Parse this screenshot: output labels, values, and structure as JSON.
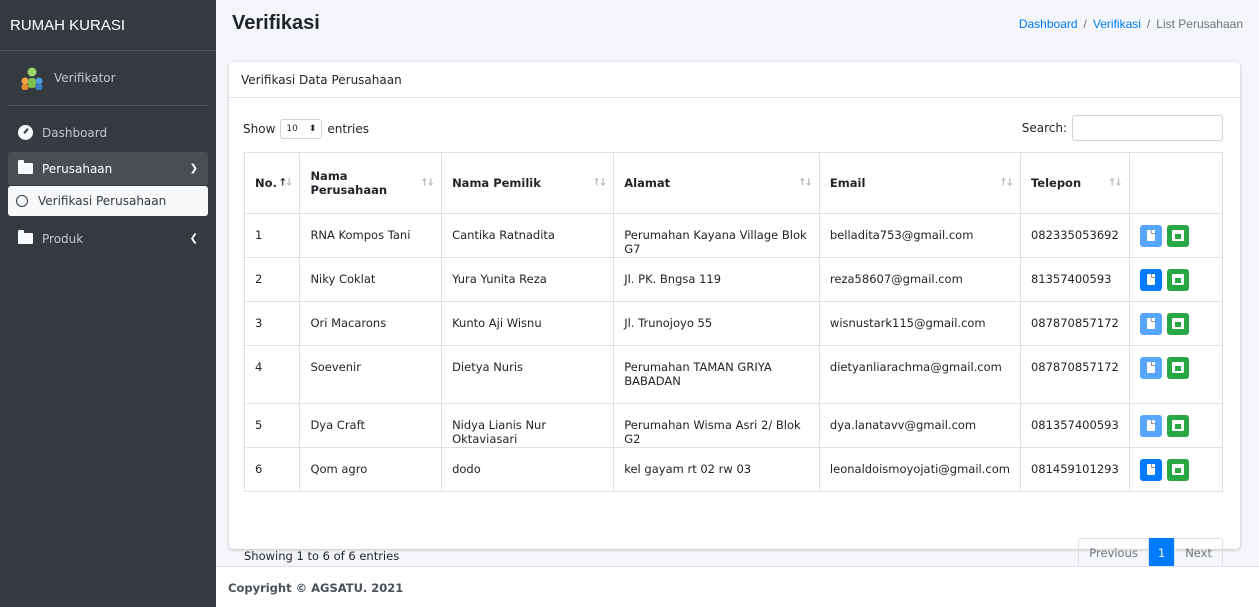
{
  "brand": "RUMAH KURASI",
  "user": {
    "name": "Verifikator"
  },
  "nav": {
    "dashboard": "Dashboard",
    "perusahaan": "Perusahaan",
    "verifikasi_perusahaan": "Verifikasi Perusahaan",
    "produk": "Produk"
  },
  "header": {
    "title": "Verifikasi",
    "breadcrumb": [
      "Dashboard",
      "Verifikasi",
      "List Perusahaan"
    ]
  },
  "card": {
    "title": "Verifikasi Data Perusahaan",
    "show_label": "Show",
    "entries_value": "10",
    "entries_label": "entries",
    "search_label": "Search:"
  },
  "table": {
    "columns": [
      "No.",
      "Nama Perusahaan",
      "Nama Pemilik",
      "Alamat",
      "Email",
      "Telepon"
    ],
    "rows": [
      {
        "no": "1",
        "nama": "RNA Kompos Tani",
        "pemilik": "Cantika Ratnadita",
        "alamat": "Perumahan Kayana Village Blok G7",
        "email": "belladita753@gmail.com",
        "telepon": "082335053692"
      },
      {
        "no": "2",
        "nama": "Niky Coklat",
        "pemilik": "Yura Yunita Reza",
        "alamat": "Jl. PK. Bngsa 119",
        "email": "reza58607@gmail.com",
        "telepon": "81357400593"
      },
      {
        "no": "3",
        "nama": "Ori Macarons",
        "pemilik": "Kunto Aji Wisnu",
        "alamat": "Jl. Trunojoyo 55",
        "email": "wisnustark115@gmail.com",
        "telepon": "087870857172"
      },
      {
        "no": "4",
        "nama": "Soevenir",
        "pemilik": "Dietya Nuris",
        "alamat": "Perumahan TAMAN GRIYA BABADAN",
        "email": "dietyanliarachma@gmail.com",
        "telepon": "087870857172"
      },
      {
        "no": "5",
        "nama": "Dya Craft",
        "pemilik": "Nidya Lianis Nur Oktaviasari",
        "alamat": "Perumahan Wisma Asri 2/ Blok G2",
        "email": "dya.lanatavv@gmail.com",
        "telepon": "081357400593"
      },
      {
        "no": "6",
        "nama": "Qom agro",
        "pemilik": "dodo",
        "alamat": "kel gayam rt 02 rw 03",
        "email": "leonaldoismoyojati@gmail.com",
        "telepon": "081459101293"
      }
    ]
  },
  "pagination": {
    "info": "Showing 1 to 6 of 6 entries",
    "previous": "Previous",
    "current": "1",
    "next": "Next"
  },
  "footer": "Copyright © AGSATU. 2021",
  "colors": {
    "sidebar": "#343a40",
    "primary": "#007bff",
    "success": "#28a745"
  }
}
